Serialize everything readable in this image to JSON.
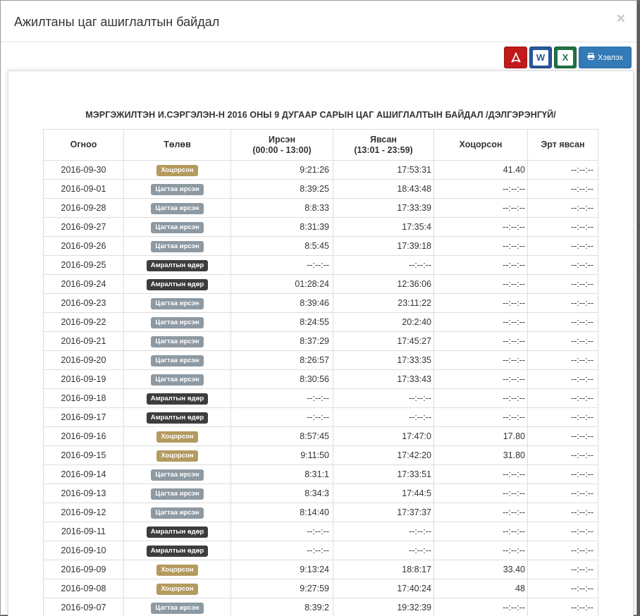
{
  "modal": {
    "title": "Ажилтаны цаг ашиглалтын байдал",
    "close_label": "×"
  },
  "toolbar": {
    "pdf_icon": "pdf-icon",
    "word_label": "W",
    "excel_label": "X",
    "print_label": "Хэвлэх"
  },
  "report": {
    "title": "МЭРГЭЖИЛТЭН И.СЭРГЭЛЭН-Н 2016 ОНЫ 9 ДУГААР САРЫН ЦАГ АШИГЛАЛТЫН БАЙДАЛ /ДЭЛГЭРЭНГҮЙ/",
    "columns": {
      "date": "Огноо",
      "status": "Төлөв",
      "in_title": "Ирсэн",
      "in_range": "(00:00 - 13:00)",
      "out_title": "Явсан",
      "out_range": "(13:01 - 23:59)",
      "late": "Хоцорсон",
      "early": "Эрт явсан"
    },
    "status_colors": {
      "late": "#b59a5e",
      "ontime": "#8e9aa3",
      "holiday": "#3d3d3d"
    },
    "rows": [
      {
        "date": "2016-09-30",
        "status": "Хоцорсон",
        "status_type": "late",
        "in": "9:21:26",
        "out": "17:53:31",
        "late": "41.40",
        "early": "--:--:--"
      },
      {
        "date": "2016-09-01",
        "status": "Цагтаа ирсэн",
        "status_type": "ontime",
        "in": "8:39:25",
        "out": "18:43:48",
        "late": "--:--:--",
        "early": "--:--:--"
      },
      {
        "date": "2016-09-28",
        "status": "Цагтаа ирсэн",
        "status_type": "ontime",
        "in": "8:8:33",
        "out": "17:33:39",
        "late": "--:--:--",
        "early": "--:--:--"
      },
      {
        "date": "2016-09-27",
        "status": "Цагтаа ирсэн",
        "status_type": "ontime",
        "in": "8:31:39",
        "out": "17:35:4",
        "late": "--:--:--",
        "early": "--:--:--"
      },
      {
        "date": "2016-09-26",
        "status": "Цагтаа ирсэн",
        "status_type": "ontime",
        "in": "8:5:45",
        "out": "17:39:18",
        "late": "--:--:--",
        "early": "--:--:--"
      },
      {
        "date": "2016-09-25",
        "status": "Амралтын өдөр",
        "status_type": "holiday",
        "in": "--:--:--",
        "out": "--:--:--",
        "late": "--:--:--",
        "early": "--:--:--"
      },
      {
        "date": "2016-09-24",
        "status": "Амралтын өдөр",
        "status_type": "holiday",
        "in": "01:28:24",
        "out": "12:36:06",
        "late": "--:--:--",
        "early": "--:--:--"
      },
      {
        "date": "2016-09-23",
        "status": "Цагтаа ирсэн",
        "status_type": "ontime",
        "in": "8:39:46",
        "out": "23:11:22",
        "late": "--:--:--",
        "early": "--:--:--"
      },
      {
        "date": "2016-09-22",
        "status": "Цагтаа ирсэн",
        "status_type": "ontime",
        "in": "8:24:55",
        "out": "20:2:40",
        "late": "--:--:--",
        "early": "--:--:--"
      },
      {
        "date": "2016-09-21",
        "status": "Цагтаа ирсэн",
        "status_type": "ontime",
        "in": "8:37:29",
        "out": "17:45:27",
        "late": "--:--:--",
        "early": "--:--:--"
      },
      {
        "date": "2016-09-20",
        "status": "Цагтаа ирсэн",
        "status_type": "ontime",
        "in": "8:26:57",
        "out": "17:33:35",
        "late": "--:--:--",
        "early": "--:--:--"
      },
      {
        "date": "2016-09-19",
        "status": "Цагтаа ирсэн",
        "status_type": "ontime",
        "in": "8:30:56",
        "out": "17:33:43",
        "late": "--:--:--",
        "early": "--:--:--"
      },
      {
        "date": "2016-09-18",
        "status": "Амралтын өдөр",
        "status_type": "holiday",
        "in": "--:--:--",
        "out": "--:--:--",
        "late": "--:--:--",
        "early": "--:--:--"
      },
      {
        "date": "2016-09-17",
        "status": "Амралтын өдөр",
        "status_type": "holiday",
        "in": "--:--:--",
        "out": "--:--:--",
        "late": "--:--:--",
        "early": "--:--:--"
      },
      {
        "date": "2016-09-16",
        "status": "Хоцорсон",
        "status_type": "late",
        "in": "8:57:45",
        "out": "17:47:0",
        "late": "17.80",
        "early": "--:--:--"
      },
      {
        "date": "2016-09-15",
        "status": "Хоцорсон",
        "status_type": "late",
        "in": "9:11:50",
        "out": "17:42:20",
        "late": "31.80",
        "early": "--:--:--"
      },
      {
        "date": "2016-09-14",
        "status": "Цагтаа ирсэн",
        "status_type": "ontime",
        "in": "8:31:1",
        "out": "17:33:51",
        "late": "--:--:--",
        "early": "--:--:--"
      },
      {
        "date": "2016-09-13",
        "status": "Цагтаа ирсэн",
        "status_type": "ontime",
        "in": "8:34:3",
        "out": "17:44:5",
        "late": "--:--:--",
        "early": "--:--:--"
      },
      {
        "date": "2016-09-12",
        "status": "Цагтаа ирсэн",
        "status_type": "ontime",
        "in": "8:14:40",
        "out": "17:37:37",
        "late": "--:--:--",
        "early": "--:--:--"
      },
      {
        "date": "2016-09-11",
        "status": "Амралтын өдөр",
        "status_type": "holiday",
        "in": "--:--:--",
        "out": "--:--:--",
        "late": "--:--:--",
        "early": "--:--:--"
      },
      {
        "date": "2016-09-10",
        "status": "Амралтын өдөр",
        "status_type": "holiday",
        "in": "--:--:--",
        "out": "--:--:--",
        "late": "--:--:--",
        "early": "--:--:--"
      },
      {
        "date": "2016-09-09",
        "status": "Хоцорсон",
        "status_type": "late",
        "in": "9:13:24",
        "out": "18:8:17",
        "late": "33.40",
        "early": "--:--:--"
      },
      {
        "date": "2016-09-08",
        "status": "Хоцорсон",
        "status_type": "late",
        "in": "9:27:59",
        "out": "17:40:24",
        "late": "48",
        "early": "--:--:--"
      },
      {
        "date": "2016-09-07",
        "status": "Цагтаа ирсэн",
        "status_type": "ontime",
        "in": "8:39:2",
        "out": "19:32:39",
        "late": "--:--:--",
        "early": "--:--:--"
      }
    ]
  }
}
